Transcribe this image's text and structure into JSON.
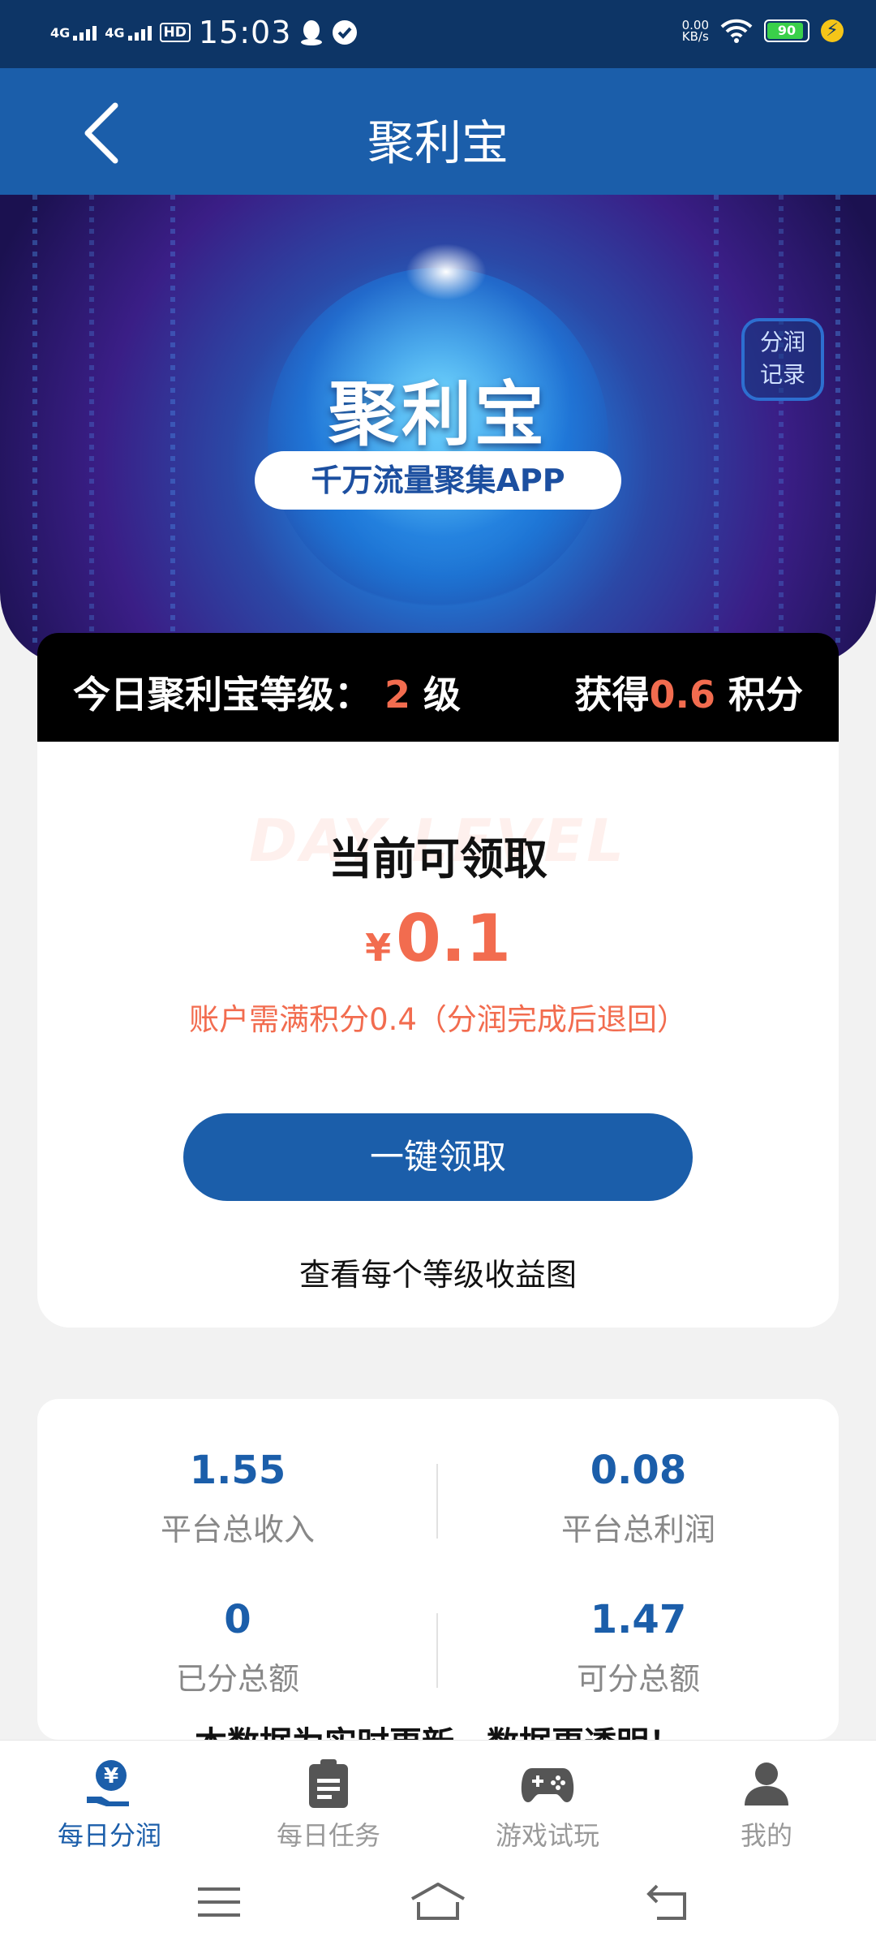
{
  "status_bar": {
    "time": "15:03",
    "signal1": "4G",
    "signal2": "4G",
    "hd": "HD",
    "net_speed_value": "0.00",
    "net_speed_unit": "KB/s",
    "battery": "90",
    "icons": [
      "signal-icon",
      "qq-icon",
      "check-icon",
      "wifi-icon",
      "battery-icon",
      "charging-icon"
    ]
  },
  "appbar": {
    "title": "聚利宝"
  },
  "banner": {
    "logo": "聚利宝",
    "slogan": "千万流量聚集APP",
    "record_line1": "分润",
    "record_line2": "记录"
  },
  "level": {
    "prefix": "今日聚利宝等级：",
    "value": "2",
    "suffix": "级",
    "earn_prefix": "获得",
    "earn_value": "0.6",
    "earn_suffix": "积分"
  },
  "claim": {
    "watermark": "DAY LEVEL",
    "title": "当前可领取",
    "currency": "¥",
    "amount": "0.1",
    "notice": "账户需满积分0.4（分润完成后退回）",
    "button": "一键领取",
    "chart_link": "查看每个等级收益图"
  },
  "stats": [
    {
      "value": "1.55",
      "label": "平台总收入"
    },
    {
      "value": "0.08",
      "label": "平台总利润"
    },
    {
      "value": "0",
      "label": "已分总额"
    },
    {
      "value": "1.47",
      "label": "可分总额"
    }
  ],
  "stats_note": "本数据为实时更新，数据更透明！",
  "tabs": [
    {
      "label": "每日分润",
      "icon": "yen-hand-icon",
      "active": true
    },
    {
      "label": "每日任务",
      "icon": "clipboard-icon",
      "active": false
    },
    {
      "label": "游戏试玩",
      "icon": "gamepad-icon",
      "active": false
    },
    {
      "label": "我的",
      "icon": "user-icon",
      "active": false
    }
  ],
  "colors": {
    "primary": "#1b5eaa",
    "accent": "#f26c4f",
    "statusbar": "#0d3566"
  }
}
